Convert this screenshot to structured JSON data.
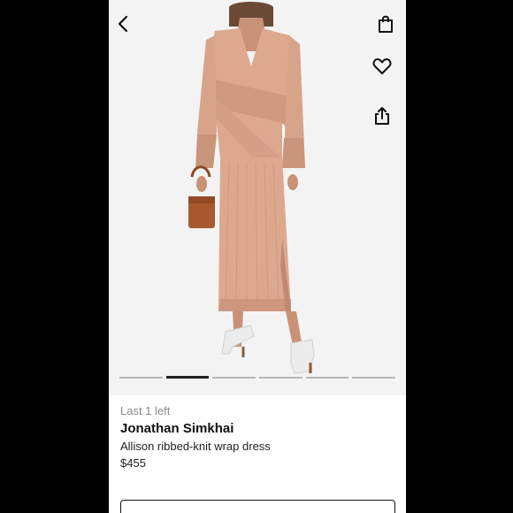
{
  "icons": {
    "back": "chevron-left-icon",
    "bag": "shopping-bag-icon",
    "wishlist": "heart-icon",
    "share": "share-icon"
  },
  "gallery": {
    "image_count": 6,
    "active_index": 1
  },
  "product": {
    "stock_note": "Last 1 left",
    "brand": "Jonathan Simkhai",
    "name": "Allison ribbed-knit wrap dress",
    "price": "$455"
  },
  "colors": {
    "dress": "#dca98f",
    "background": "#f3f3f3",
    "text": "#111111",
    "muted": "#8a8a8a"
  }
}
